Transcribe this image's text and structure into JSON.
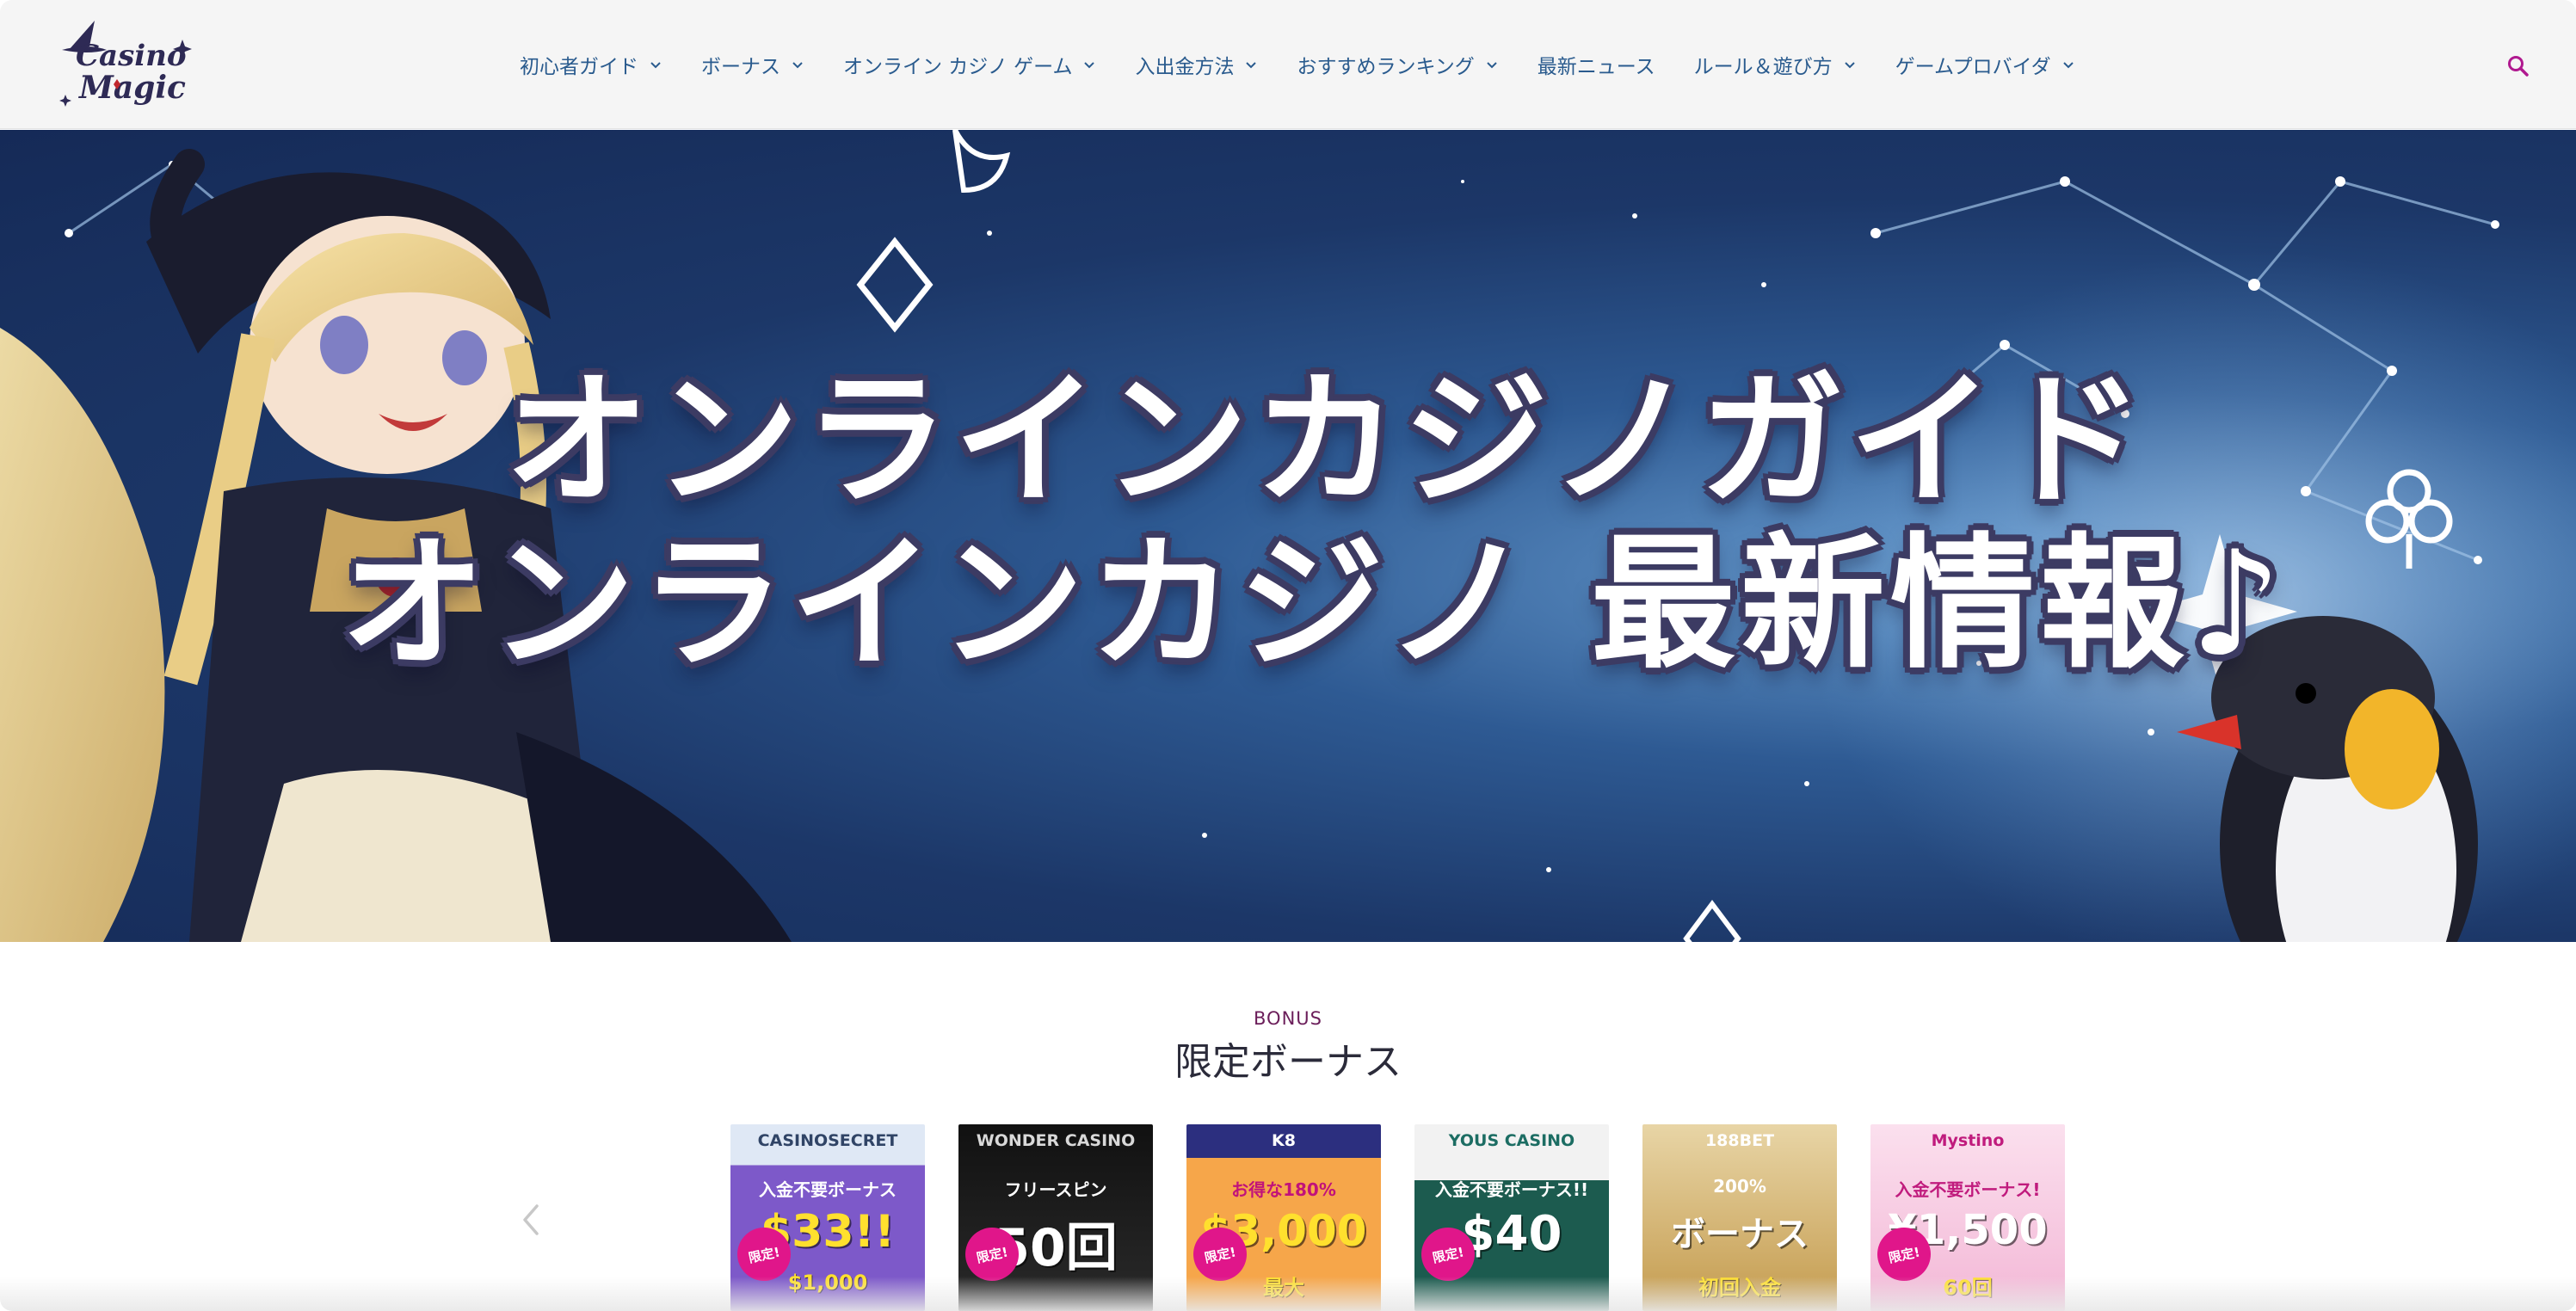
{
  "brand": {
    "logo_text_1": "Casino",
    "logo_text_2": "Magic"
  },
  "nav": [
    {
      "label": "初心者ガイド",
      "has_dropdown": true
    },
    {
      "label": "ボーナス",
      "has_dropdown": true
    },
    {
      "label": "オンライン カジノ ゲーム",
      "has_dropdown": true
    },
    {
      "label": "入出金方法",
      "has_dropdown": true
    },
    {
      "label": "おすすめランキング",
      "has_dropdown": true
    },
    {
      "label": "最新ニュース",
      "has_dropdown": false
    },
    {
      "label": "ルール＆遊び方",
      "has_dropdown": true
    },
    {
      "label": "ゲームプロバイダ",
      "has_dropdown": true
    }
  ],
  "icons": {
    "search": "search-icon",
    "chevron": "chevron-down-icon",
    "prev": "chevron-left-icon"
  },
  "hero": {
    "line1": "オンラインカジノガイド",
    "line2": "オンラインカジノ 最新情報♪"
  },
  "bonus": {
    "eyebrow": "BONUS",
    "title": "限定ボーナス",
    "cards": [
      {
        "brand": "CASINOSECRET",
        "headline": "入金不要ボーナス",
        "amount": "$33!!",
        "sub": "$1,000",
        "badge": "限定!"
      },
      {
        "brand": "WONDER CASINO",
        "headline": "フリースピン",
        "amount": "50回",
        "sub": "",
        "badge": "限定!"
      },
      {
        "brand": "K8",
        "headline": "お得な180%",
        "amount": "$3,000",
        "sub": "最大",
        "badge": "限定!"
      },
      {
        "brand": "YOUS CASINO",
        "headline": "入金不要ボーナス!!",
        "amount": "$40",
        "sub": "",
        "badge": "限定!"
      },
      {
        "brand": "188BET",
        "headline": "200%",
        "amount": "ボーナス",
        "sub": "初回入金",
        "badge": ""
      },
      {
        "brand": "Mystino",
        "headline": "入金不要ボーナス!",
        "amount": "¥1,500",
        "sub": "60回",
        "badge": "限定!"
      }
    ]
  },
  "colors": {
    "nav_text": "#2a5b8e",
    "accent": "#b0198f",
    "bonus_eyebrow": "#6b1e5a",
    "hero_bg": "#1c3768"
  }
}
